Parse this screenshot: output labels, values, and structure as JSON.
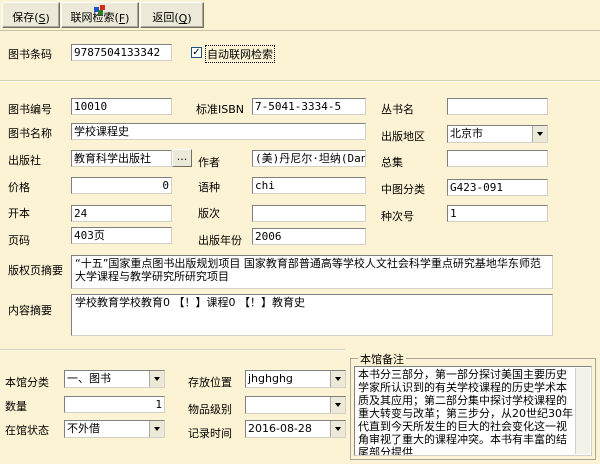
{
  "toolbar": {
    "save_label": "保存(",
    "save_key": "S",
    "online_label": "联网检索(",
    "online_key": "F",
    "back_label": "返回(",
    "back_key": "Q"
  },
  "barcode": {
    "label": "图书条码",
    "value": "9787504133342"
  },
  "auto_search": {
    "label": "自动联网检索",
    "checked": true
  },
  "fields": {
    "book_no": {
      "label": "图书编号",
      "value": "10010"
    },
    "isbn": {
      "label": "标准ISBN",
      "value": "7-5041-3334-5"
    },
    "series": {
      "label": "丛书名",
      "value": ""
    },
    "title": {
      "label": "图书名称",
      "value": "学校课程史"
    },
    "region": {
      "label": "出版地区",
      "value": "北京市"
    },
    "publisher": {
      "label": "出版社",
      "value": "教育科学出版社",
      "browse": "..."
    },
    "author": {
      "label": "作者",
      "value": "(美)丹尼尔·坦纳(Dan"
    },
    "collection": {
      "label": "总集",
      "value": ""
    },
    "price": {
      "label": "价格",
      "value": "0"
    },
    "language": {
      "label": "语种",
      "value": "chi"
    },
    "clc": {
      "label": "中图分类",
      "value": "G423-091"
    },
    "format": {
      "label": "开本",
      "value": "24"
    },
    "edition": {
      "label": "版次",
      "value": ""
    },
    "copy_no": {
      "label": "种次号",
      "value": "1"
    },
    "pages": {
      "label": "页码",
      "value": "403页"
    },
    "pub_year": {
      "label": "出版年份",
      "value": "2006"
    }
  },
  "copyright_abstract": {
    "label": "版权页摘要",
    "value": "“十五”国家重点图书出版规划项目 国家教育部普通高等学校人文社会科学重点研究基地华东师范大学课程与教学研究所研究项目"
  },
  "content_abstract": {
    "label": "内容摘要",
    "value": "学校教育学校教育0 【！】课程0 【！】教育史"
  },
  "bottom": {
    "category": {
      "label": "本馆分类",
      "value": "一、图书"
    },
    "location": {
      "label": "存放位置",
      "value": "jhghghg"
    },
    "quantity": {
      "label": "数量",
      "value": "1"
    },
    "level": {
      "label": "物品级别",
      "value": ""
    },
    "status": {
      "label": "在馆状态",
      "value": "不外借"
    },
    "record_time": {
      "label": "记录时间",
      "value": "2016-08-28"
    }
  },
  "notes": {
    "label": "本馆备注",
    "value": "本书分三部分，第一部分探讨美国主要历史学家所认识到的有关学校课程的历史学术本质及其应用；第二部分集中探讨学校课程的重大转变与改革；第三步分，从20世纪30年代直到今天所发生的巨大的社会变化这一视角审视了重大的课程冲突。本书有丰富的结尾部分提供"
  },
  "colors": {
    "background": "#fcf3d4",
    "button_face": "#ece9d8"
  }
}
